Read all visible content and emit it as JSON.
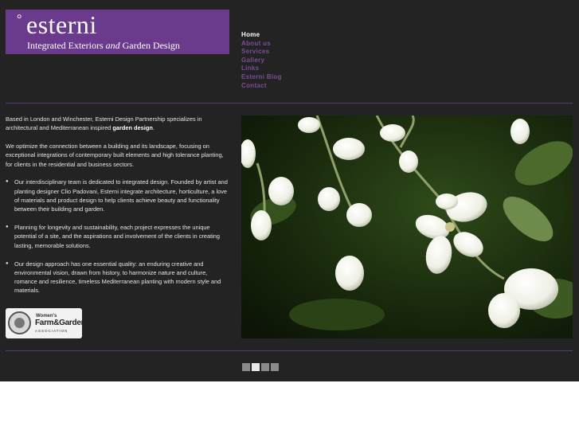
{
  "logo": {
    "degree": "°",
    "name": "esterni",
    "tagline_part1": "Integrated Exteriors ",
    "tagline_and": "and",
    "tagline_part2": " Garden Design"
  },
  "nav": {
    "items": [
      {
        "label": "Home",
        "active": true
      },
      {
        "label": "About us"
      },
      {
        "label": "Services"
      },
      {
        "label": "Gallery"
      },
      {
        "label": "Links"
      },
      {
        "label": "Esterni Blog"
      },
      {
        "label": "Contact"
      }
    ]
  },
  "content": {
    "intro_text": "Based in London and Winchester, Esterni Design Partnership specializes in architectural and Mediterranean inspired ",
    "intro_bold": "garden design",
    "intro_end": ".",
    "p2": "We optimize the connection between a building and its landscape, focusing on exceptional integrations of contemporary built elements and high tolerance planting, for clients in the residential and business sectors.",
    "bullets": [
      "Our interdisciplinary team is dedicated to integrated design. Founded by artist and planting designer Clio Padovani, Esterni integrate architecture, horticulture, a love of materials and product design to help clients achieve beauty and functionality between their building and garden.",
      "Planning for longevity and sustainability, each project expresses the unique potential of a site, and the aspirations and involvement of the clients in creating lasting, memorable solutions.",
      "Our design approach has one essential quality: an enduring creative and environmental vision, drawn from history, to harmonize nature and culture, romance and resilience, timeless Mediterranean planting with modern style and materials."
    ]
  },
  "badge": {
    "line1": "Women's",
    "line2": "Farm&Garden",
    "line3": "ASSOCIATION"
  },
  "slideshow": {
    "active_index": 1,
    "count": 4
  },
  "colors": {
    "background": "#232323",
    "brand_purple": "#6a3b8c",
    "nav_link": "#7a4d9a",
    "rule": "#5b3a78"
  }
}
